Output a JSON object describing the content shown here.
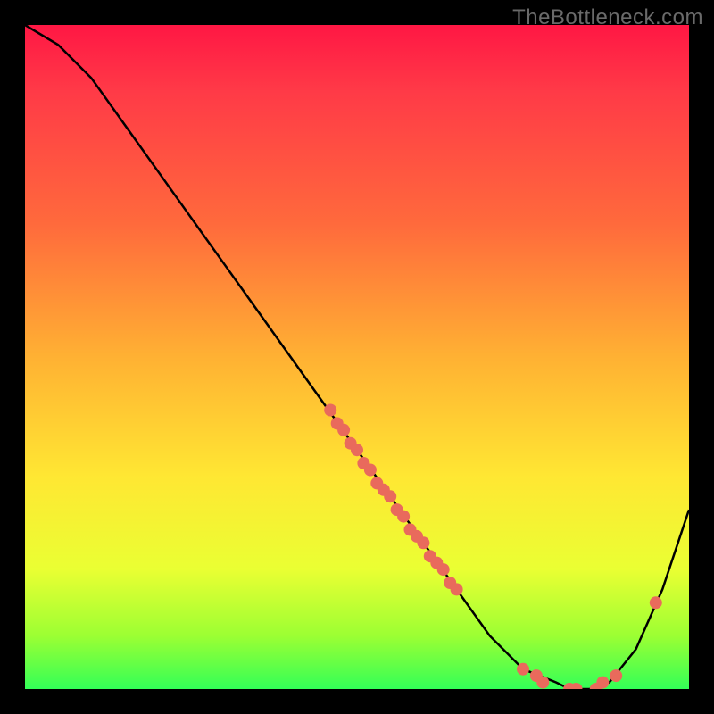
{
  "watermark": "TheBottleneck.com",
  "chart_data": {
    "type": "line",
    "title": "",
    "xlabel": "",
    "ylabel": "",
    "xlim": [
      0,
      100
    ],
    "ylim": [
      0,
      100
    ],
    "series": [
      {
        "name": "curve",
        "x": [
          0,
          5,
          10,
          15,
          20,
          25,
          30,
          35,
          40,
          45,
          50,
          55,
          60,
          65,
          70,
          75,
          80,
          82,
          85,
          88,
          92,
          96,
          100
        ],
        "y": [
          100,
          97,
          92,
          85,
          78,
          71,
          64,
          57,
          50,
          43,
          36,
          29,
          22,
          15,
          8,
          3,
          1,
          0,
          0,
          1,
          6,
          15,
          27
        ]
      }
    ],
    "points": [
      {
        "x": 46,
        "y": 42
      },
      {
        "x": 47,
        "y": 40
      },
      {
        "x": 48,
        "y": 39
      },
      {
        "x": 49,
        "y": 37
      },
      {
        "x": 50,
        "y": 36
      },
      {
        "x": 51,
        "y": 34
      },
      {
        "x": 52,
        "y": 33
      },
      {
        "x": 53,
        "y": 31
      },
      {
        "x": 54,
        "y": 30
      },
      {
        "x": 55,
        "y": 29
      },
      {
        "x": 56,
        "y": 27
      },
      {
        "x": 57,
        "y": 26
      },
      {
        "x": 58,
        "y": 24
      },
      {
        "x": 59,
        "y": 23
      },
      {
        "x": 60,
        "y": 22
      },
      {
        "x": 61,
        "y": 20
      },
      {
        "x": 62,
        "y": 19
      },
      {
        "x": 63,
        "y": 18
      },
      {
        "x": 64,
        "y": 16
      },
      {
        "x": 65,
        "y": 15
      },
      {
        "x": 75,
        "y": 3
      },
      {
        "x": 77,
        "y": 2
      },
      {
        "x": 78,
        "y": 1
      },
      {
        "x": 82,
        "y": 0
      },
      {
        "x": 83,
        "y": 0
      },
      {
        "x": 86,
        "y": 0
      },
      {
        "x": 87,
        "y": 1
      },
      {
        "x": 89,
        "y": 2
      },
      {
        "x": 95,
        "y": 13
      }
    ]
  }
}
